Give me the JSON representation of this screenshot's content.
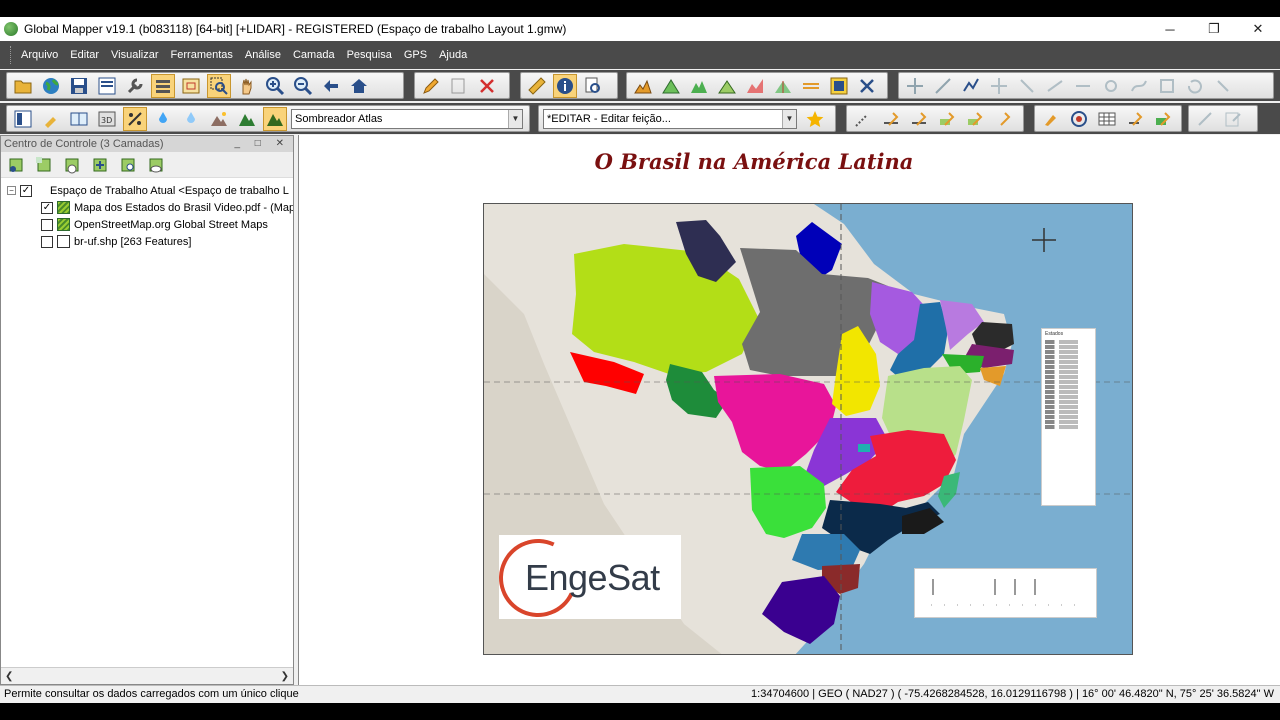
{
  "window": {
    "title": "Global Mapper v19.1 (b083118) [64-bit] [+LIDAR] - REGISTERED (Espaço de trabalho Layout 1.gmw)",
    "minimize_glyph": "─",
    "maximize_glyph": "❐",
    "close_glyph": "✕"
  },
  "menu": [
    "Arquivo",
    "Editar",
    "Visualizar",
    "Ferramentas",
    "Análise",
    "Camada",
    "Pesquisa",
    "GPS",
    "Ajuda"
  ],
  "toolbar": {
    "shader_combo": "Sombreador Atlas",
    "edit_combo": "*EDITAR - Editar feição..."
  },
  "control_center": {
    "header": "Centro de Controle (3 Camadas)",
    "tree": [
      {
        "label": "Espaço de Trabalho Atual <Espaço de trabalho L",
        "checked": true,
        "level": 0
      },
      {
        "label": "Mapa dos Estados do Brasil Video.pdf - (Map",
        "checked": true,
        "level": 1
      },
      {
        "label": "OpenStreetMap.org Global Street Maps",
        "checked": false,
        "level": 1
      },
      {
        "label": "br-uf.shp [263 Features]",
        "checked": false,
        "level": 1
      }
    ]
  },
  "map": {
    "title": "O Brasil na América Latina",
    "logo_text": "EngeSat",
    "legend_title": "Estados"
  },
  "status": {
    "message": "Permite consultar os dados carregados com um único clique",
    "scale": "1:34704600",
    "projection": "GEO ( NAD27 )",
    "coords": "( -75.4268284528, 16.0129116798 )",
    "dms": "16° 00' 46.4820\" N, 75° 25' 36.5824\" W"
  },
  "colors": {
    "menubar": "#4a4a4a",
    "ocean": "#7aaed0",
    "land": "#e6e2da",
    "title_color": "#7a1010",
    "logo_ring": "#d9452b"
  }
}
